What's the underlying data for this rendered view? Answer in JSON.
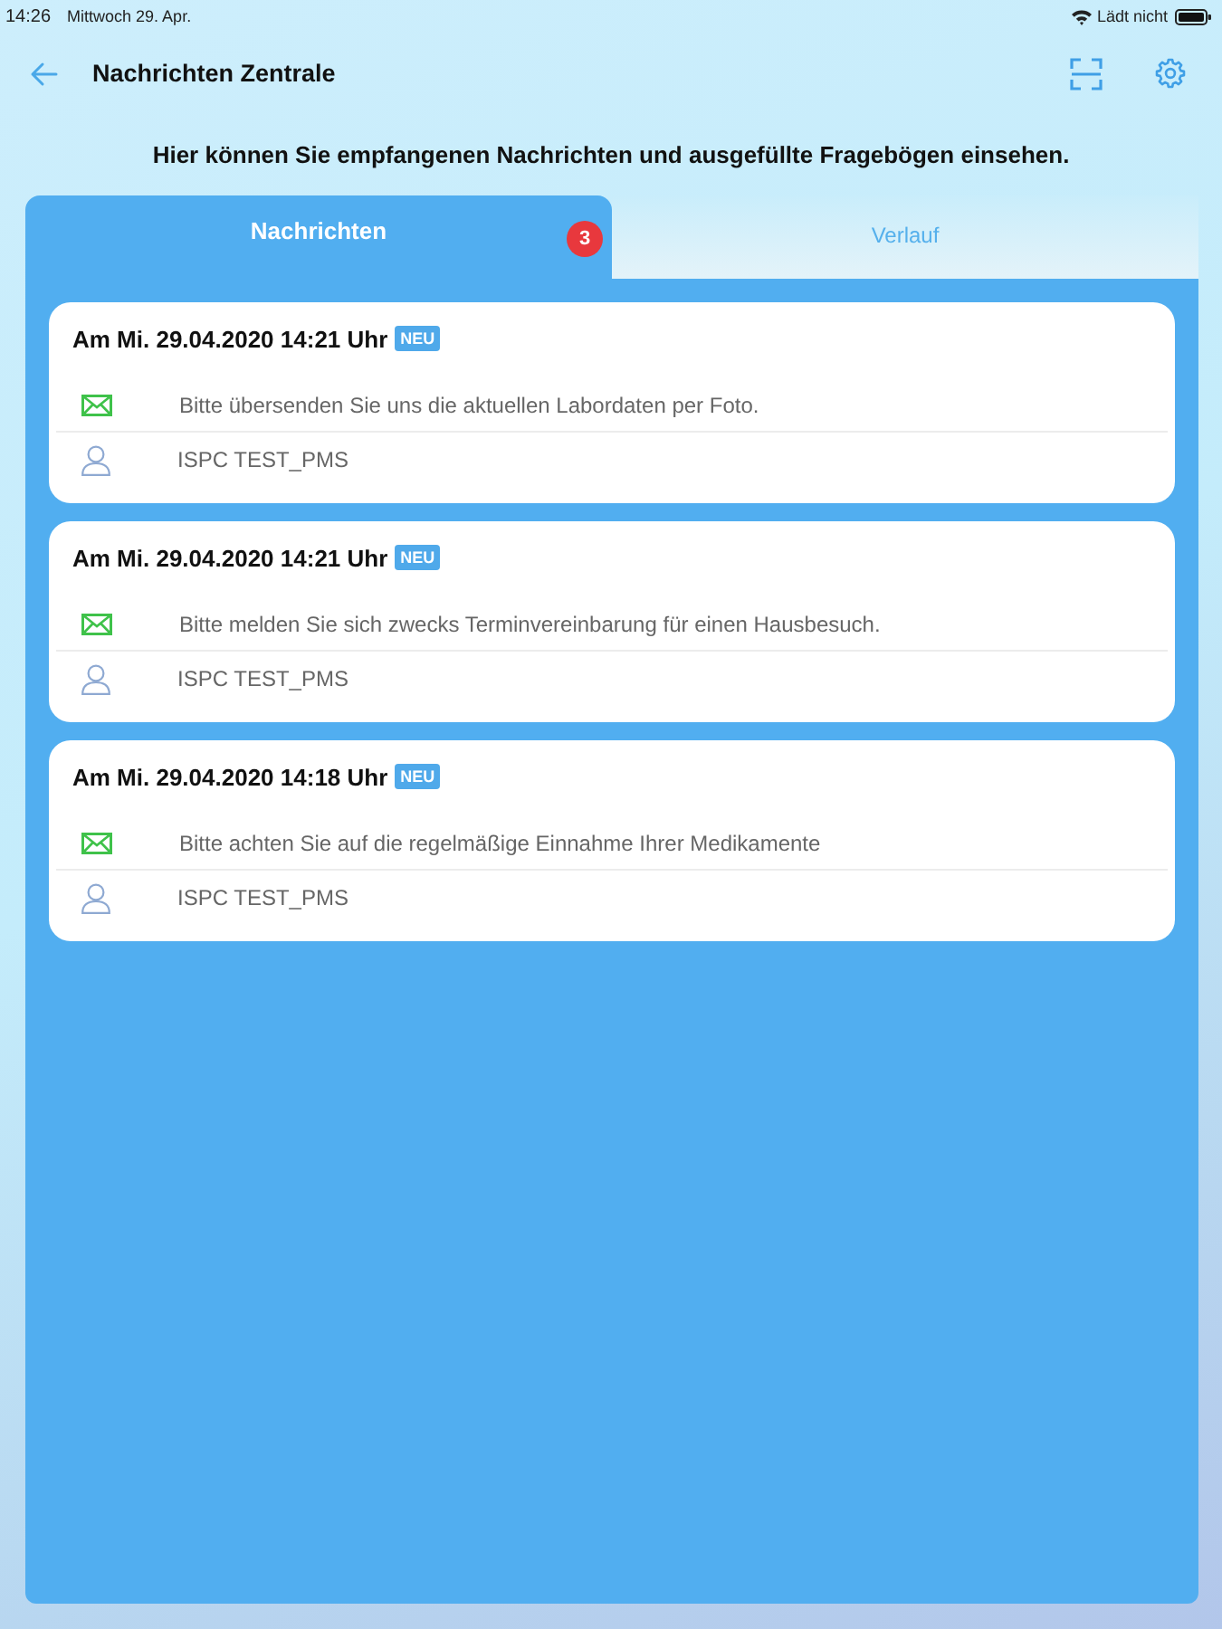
{
  "status_bar": {
    "time": "14:26",
    "date": "Mittwoch 29. Apr.",
    "charging": "Lädt nicht"
  },
  "header": {
    "title": "Nachrichten Zentrale"
  },
  "intro": "Hier können Sie empfangenen Nachrichten und ausgefüllte Fragebögen einsehen.",
  "tabs": [
    {
      "label": "Nachrichten",
      "selected": true,
      "badge": "3"
    },
    {
      "label": "Verlauf",
      "selected": false
    }
  ],
  "messages": [
    {
      "date": "Am Mi. 29.04.2020 14:21 Uhr",
      "badge": "NEU",
      "text": "Bitte übersenden Sie uns die aktuellen Labordaten per Foto.",
      "sender": "ISPC TEST_PMS"
    },
    {
      "date": "Am Mi. 29.04.2020 14:21 Uhr",
      "badge": "NEU",
      "text": "Bitte melden Sie sich zwecks Terminvereinbarung für einen Hausbesuch.",
      "sender": "ISPC TEST_PMS"
    },
    {
      "date": "Am Mi. 29.04.2020 14:18 Uhr",
      "badge": "NEU",
      "text": "Bitte achten Sie auf die regelmäßige Einnahme Ihrer Medikamente",
      "sender": "ISPC TEST_PMS"
    }
  ]
}
